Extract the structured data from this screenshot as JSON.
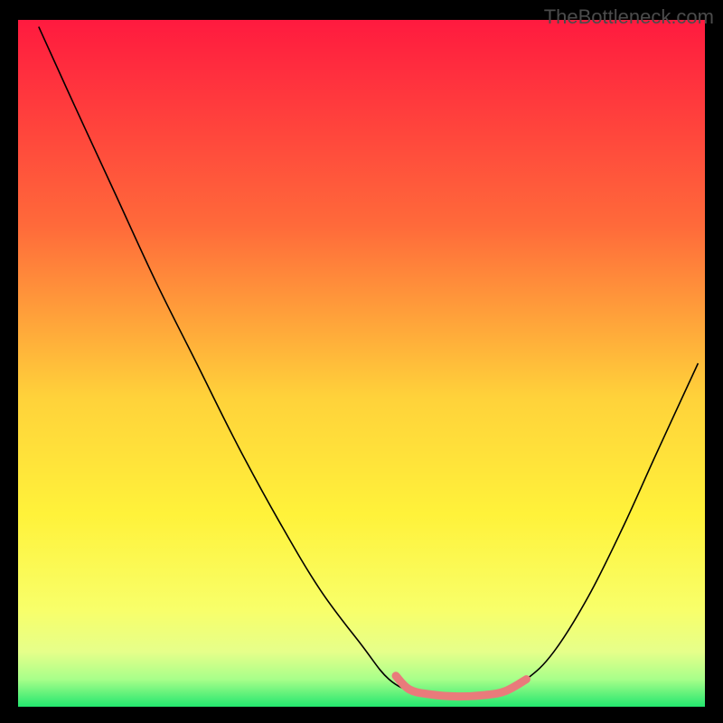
{
  "watermark": "TheBottleneck.com",
  "chart_data": {
    "type": "line",
    "title": "",
    "xlabel": "",
    "ylabel": "",
    "xlim": [
      0,
      100
    ],
    "ylim": [
      0,
      100
    ],
    "background_gradient": {
      "stops": [
        {
          "offset": 0.0,
          "color": "#ff1a3f"
        },
        {
          "offset": 0.3,
          "color": "#ff6a3a"
        },
        {
          "offset": 0.55,
          "color": "#ffd23a"
        },
        {
          "offset": 0.72,
          "color": "#fff23a"
        },
        {
          "offset": 0.86,
          "color": "#f8ff6a"
        },
        {
          "offset": 0.92,
          "color": "#e6ff8a"
        },
        {
          "offset": 0.96,
          "color": "#a8ff8a"
        },
        {
          "offset": 1.0,
          "color": "#23e66e"
        }
      ]
    },
    "series": [
      {
        "name": "bottleneck-curve",
        "color": "#000000",
        "width": 1.6,
        "points": [
          {
            "x": 3,
            "y": 99
          },
          {
            "x": 8,
            "y": 88
          },
          {
            "x": 14,
            "y": 75
          },
          {
            "x": 20,
            "y": 62
          },
          {
            "x": 26,
            "y": 50
          },
          {
            "x": 32,
            "y": 38
          },
          {
            "x": 38,
            "y": 27
          },
          {
            "x": 44,
            "y": 17
          },
          {
            "x": 50,
            "y": 9
          },
          {
            "x": 54,
            "y": 4
          },
          {
            "x": 58,
            "y": 2
          },
          {
            "x": 62,
            "y": 1.5
          },
          {
            "x": 66,
            "y": 1.5
          },
          {
            "x": 70,
            "y": 2
          },
          {
            "x": 74,
            "y": 4
          },
          {
            "x": 78,
            "y": 8
          },
          {
            "x": 83,
            "y": 16
          },
          {
            "x": 88,
            "y": 26
          },
          {
            "x": 93,
            "y": 37
          },
          {
            "x": 99,
            "y": 50
          }
        ]
      },
      {
        "name": "optimal-zone-marker",
        "color": "#e97b7b",
        "width": 9,
        "cap": "round",
        "points": [
          {
            "x": 55,
            "y": 4.5
          },
          {
            "x": 57,
            "y": 2.5
          },
          {
            "x": 60,
            "y": 1.8
          },
          {
            "x": 64,
            "y": 1.5
          },
          {
            "x": 68,
            "y": 1.7
          },
          {
            "x": 71,
            "y": 2.3
          },
          {
            "x": 74,
            "y": 4.0
          }
        ]
      }
    ]
  }
}
